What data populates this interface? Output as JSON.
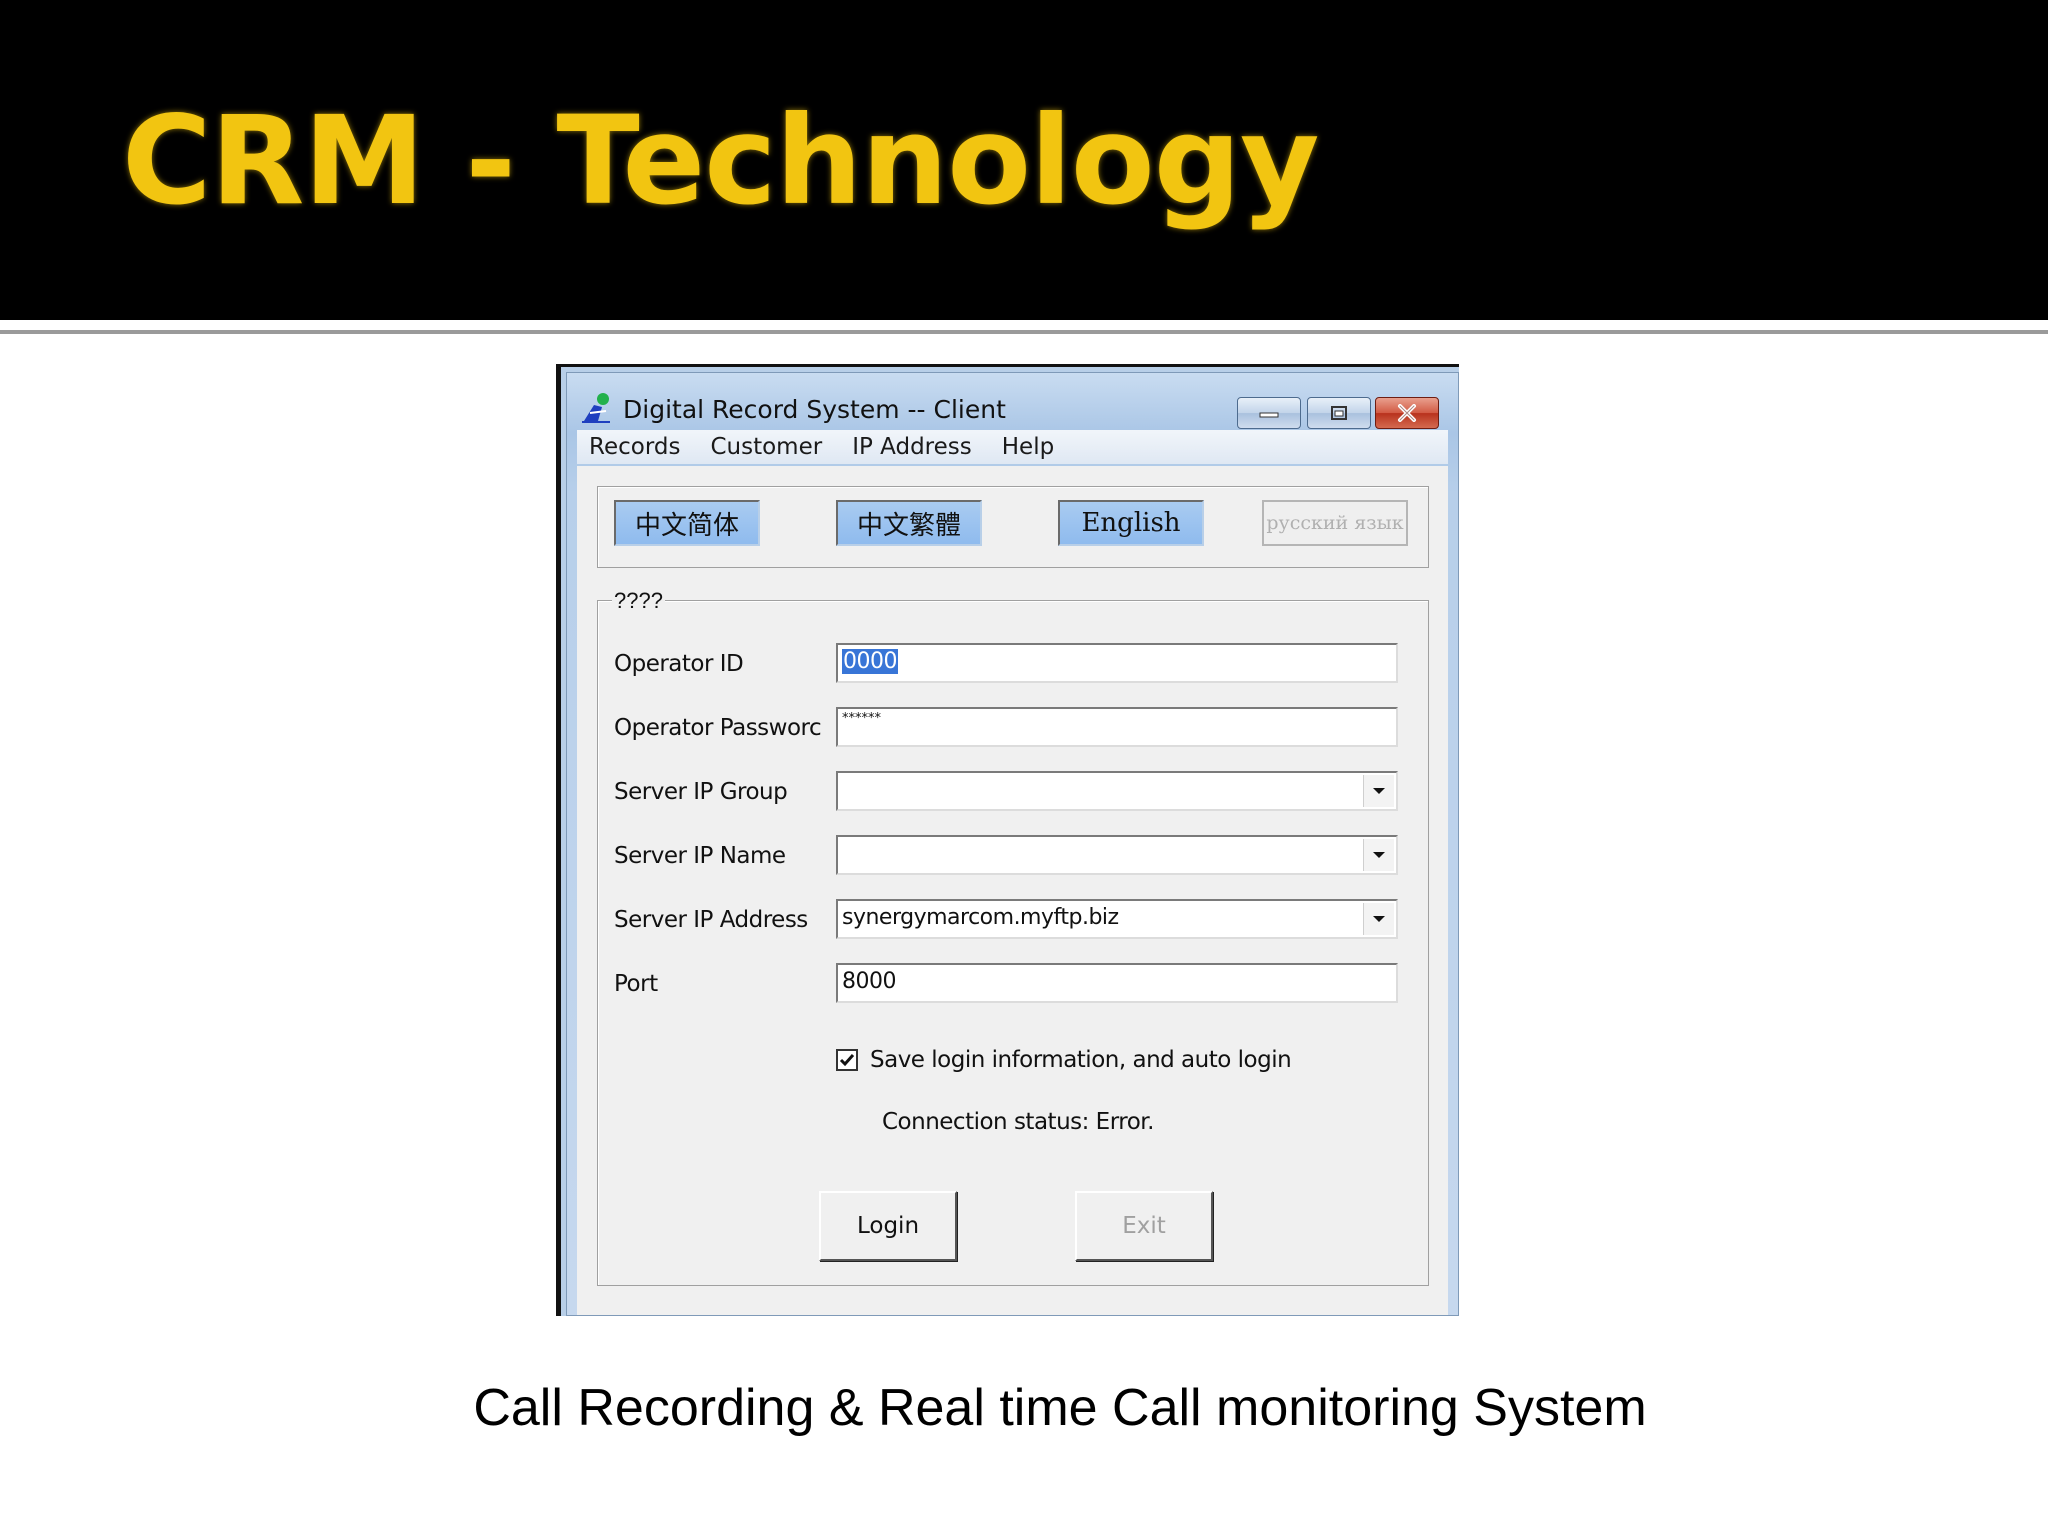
{
  "slide": {
    "title": "CRM - Technology",
    "caption": "Call Recording  & Real time Call monitoring System",
    "title_color": "#f2c511"
  },
  "window": {
    "title": "Digital Record System -- Client",
    "icon": "app-person-icon",
    "controls": [
      "minimize-icon",
      "maximize-icon",
      "close-icon"
    ]
  },
  "menu": [
    "Records",
    "Customer",
    "IP Address",
    "Help"
  ],
  "languages": [
    {
      "label": "中文简体",
      "enabled": true
    },
    {
      "label": "中文繁體",
      "enabled": true
    },
    {
      "label": "English",
      "enabled": true
    },
    {
      "label": "русский язык",
      "enabled": false
    }
  ],
  "group": {
    "legend": "????",
    "fields": {
      "operator_id": {
        "label": "Operator ID",
        "value": "0000"
      },
      "operator_password": {
        "label": "Operator Passworc",
        "value": "******"
      },
      "server_ip_group": {
        "label": "Server IP Group",
        "value": ""
      },
      "server_ip_name": {
        "label": "Server IP Name",
        "value": ""
      },
      "server_ip_address": {
        "label": "Server IP Address",
        "value": "synergymarcom.myftp.biz"
      },
      "port": {
        "label": "Port",
        "value": "8000"
      }
    },
    "save_login": {
      "label": "Save login information, and auto login",
      "checked": true
    },
    "status": "Connection status: Error.",
    "buttons": {
      "login": "Login",
      "exit": "Exit"
    }
  }
}
